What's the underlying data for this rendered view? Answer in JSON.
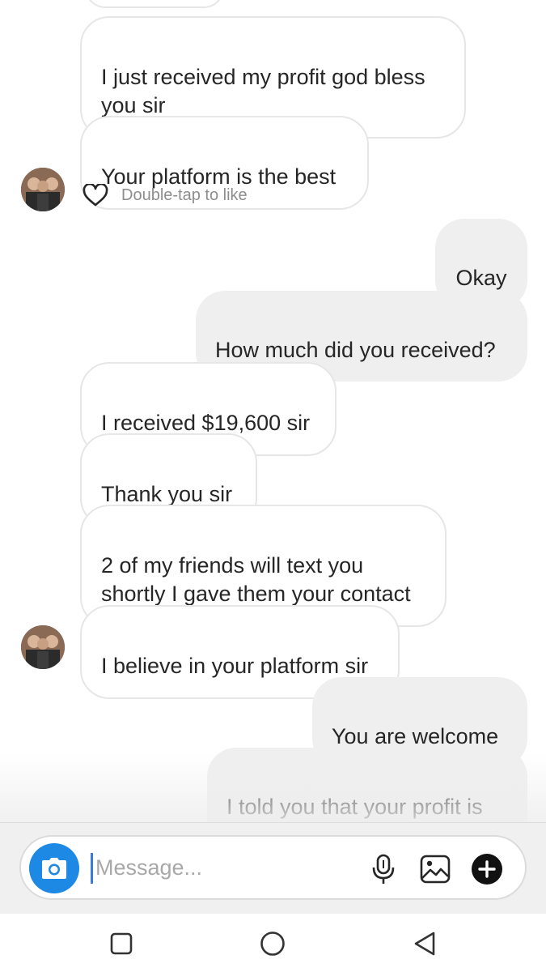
{
  "messages": [
    {
      "id": "m0",
      "side": "in",
      "text": ""
    },
    {
      "id": "m1",
      "side": "in",
      "text": "I just received my profit god bless\nyou sir"
    },
    {
      "id": "m2",
      "side": "in",
      "text": "Your platform is the best"
    },
    {
      "id": "m3",
      "side": "out",
      "text": "Okay"
    },
    {
      "id": "m4",
      "side": "out",
      "text": "How much did you received?"
    },
    {
      "id": "m5",
      "side": "in",
      "text": "I received $19,600 sir"
    },
    {
      "id": "m6",
      "side": "in",
      "text": "Thank you sir"
    },
    {
      "id": "m7",
      "side": "in",
      "text": "2 of my friends will text you\nshortly I gave them your contact"
    },
    {
      "id": "m8",
      "side": "in",
      "text": "I believe in your platform sir"
    },
    {
      "id": "m9",
      "side": "out",
      "text": "You are welcome"
    },
    {
      "id": "m10",
      "side": "out",
      "text": "I told you that your profit  is\nalways  safe in our platform"
    }
  ],
  "like_hint": "Double-tap to like",
  "composer": {
    "placeholder": "Message...",
    "icons": [
      "camera-icon",
      "microphone-icon",
      "gallery-icon",
      "plus-icon"
    ]
  },
  "navbar": {
    "icons": [
      "recent-apps-icon",
      "home-icon",
      "back-icon"
    ]
  },
  "colors": {
    "incoming_bubble_bg": "#ffffff",
    "incoming_bubble_border": "#e6e6e6",
    "outgoing_bubble_bg": "#efefef",
    "text": "#262626",
    "secondary_text": "#8e8e8e",
    "camera_button": "#1e88e5"
  }
}
